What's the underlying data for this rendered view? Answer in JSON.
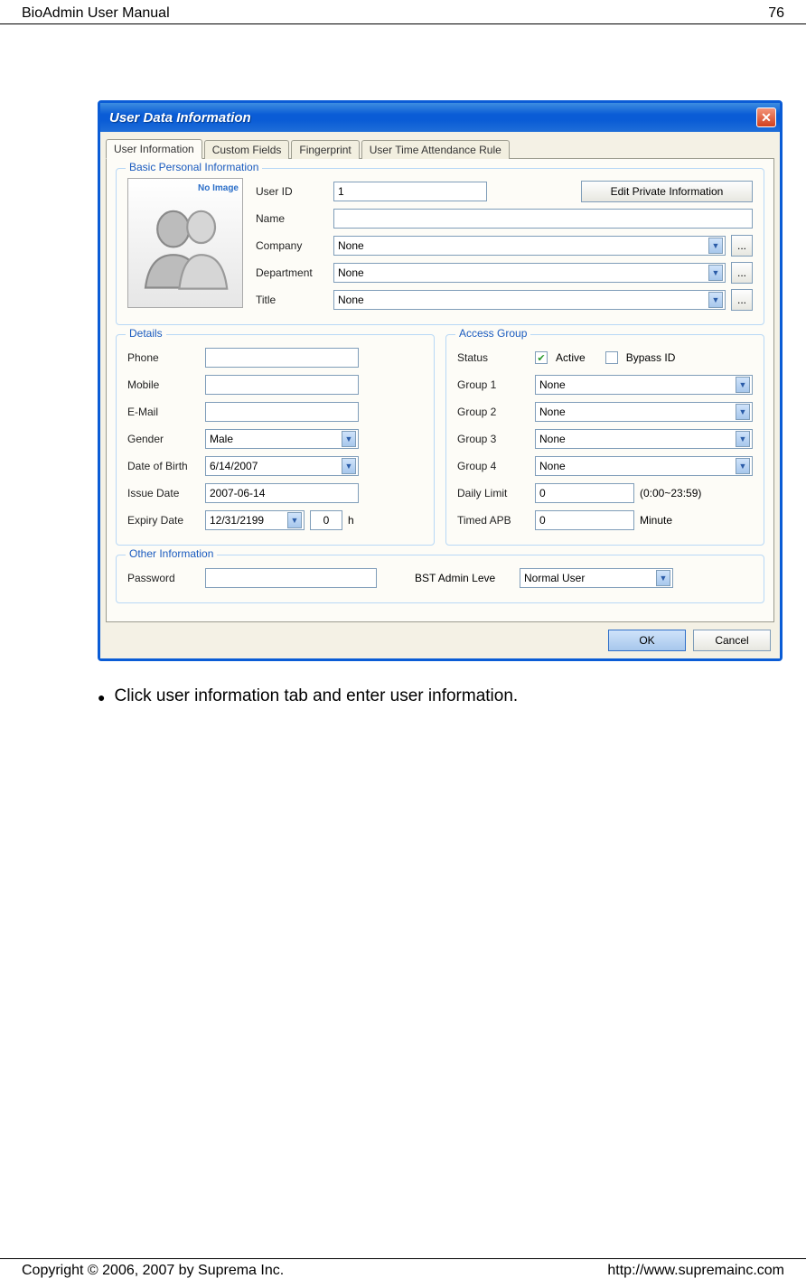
{
  "header": {
    "title": "BioAdmin User Manual",
    "page": "76"
  },
  "footer": {
    "copyright": "Copyright © 2006, 2007 by Suprema Inc.",
    "url": "http://www.supremainc.com"
  },
  "dialog": {
    "title": "User Data Information",
    "tabs": [
      "User Information",
      "Custom Fields",
      "Fingerprint",
      "User Time Attendance Rule"
    ],
    "basic": {
      "legend": "Basic Personal Information",
      "noimage_badge": "No\nImage",
      "labels": {
        "userid": "User ID",
        "name": "Name",
        "company": "Company",
        "department": "Department",
        "title": "Title"
      },
      "values": {
        "userid": "1",
        "name": "",
        "company": "None",
        "department": "None",
        "title": "None"
      },
      "edit_btn": "Edit Private Information"
    },
    "details": {
      "legend": "Details",
      "labels": {
        "phone": "Phone",
        "mobile": "Mobile",
        "email": "E-Mail",
        "gender": "Gender",
        "dob": "Date of Birth",
        "issue": "Issue Date",
        "expiry": "Expiry Date"
      },
      "values": {
        "phone": "",
        "mobile": "",
        "email": "",
        "gender": "Male",
        "dob": " 6/14/2007",
        "issue": "2007-06-14",
        "expiry": "12/31/2199",
        "expiry_h": "0",
        "expiry_h_unit": "h"
      }
    },
    "access": {
      "legend": "Access Group",
      "labels": {
        "status": "Status",
        "active": "Active",
        "bypass": "Bypass ID",
        "g1": "Group 1",
        "g2": "Group 2",
        "g3": "Group 3",
        "g4": "Group 4",
        "daily": "Daily Limit",
        "daily_hint": "(0:00~23:59)",
        "apb": "Timed APB",
        "apb_unit": "Minute"
      },
      "values": {
        "active_checked": true,
        "bypass_checked": false,
        "g1": "None",
        "g2": "None",
        "g3": "None",
        "g4": "None",
        "daily": "0",
        "apb": "0"
      }
    },
    "other": {
      "legend": "Other Information",
      "labels": {
        "password": "Password",
        "admin": "BST Admin Leve"
      },
      "values": {
        "password": "",
        "admin": "Normal User"
      }
    },
    "buttons": {
      "ok": "OK",
      "cancel": "Cancel"
    }
  },
  "instruction": "Click user information tab and enter user information."
}
